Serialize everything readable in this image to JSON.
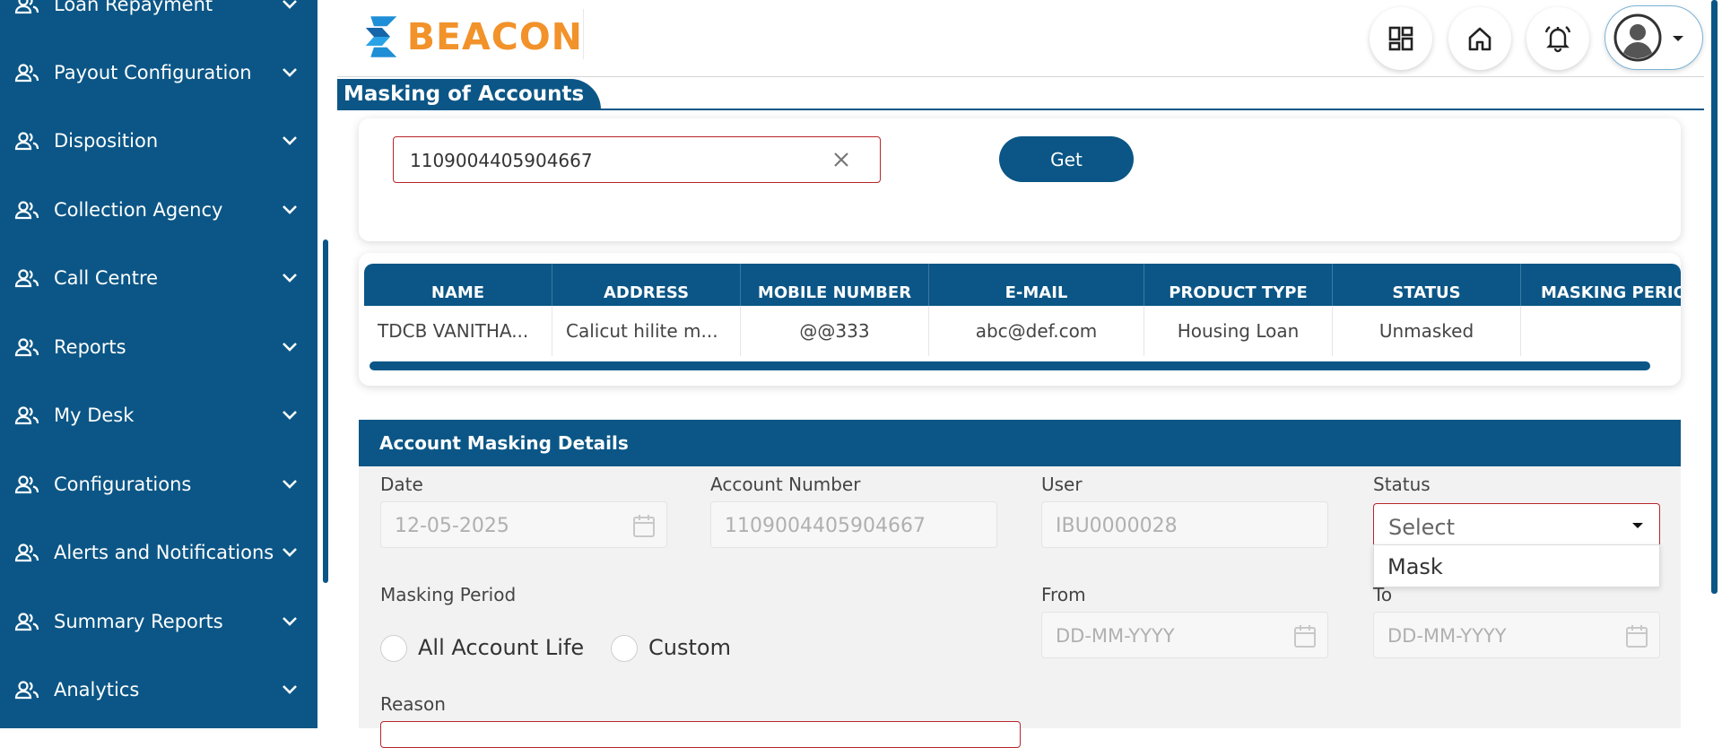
{
  "sidebar": {
    "items": [
      {
        "label": "Loan Repayment",
        "icon": "users-icon"
      },
      {
        "label": "Payout Configuration",
        "icon": "users-icon"
      },
      {
        "label": "Disposition",
        "icon": "users-icon"
      },
      {
        "label": "Collection Agency",
        "icon": "users-icon"
      },
      {
        "label": "Call Centre",
        "icon": "users-icon"
      },
      {
        "label": "Reports",
        "icon": "users-icon"
      },
      {
        "label": "My Desk",
        "icon": "users-icon"
      },
      {
        "label": "Configurations",
        "icon": "users-icon"
      },
      {
        "label": "Alerts and Notifications",
        "icon": "users-icon"
      },
      {
        "label": "Summary Reports",
        "icon": "users-icon"
      },
      {
        "label": "Analytics",
        "icon": "users-icon"
      }
    ]
  },
  "header": {
    "logo_text": "BEACON",
    "icons": [
      "dashboard-icon",
      "home-icon",
      "bell-icon",
      "avatar-icon"
    ]
  },
  "page": {
    "title": "Masking of Accounts"
  },
  "search": {
    "value": "1109004405904667",
    "get_label": "Get"
  },
  "table": {
    "columns": [
      "NAME",
      "ADDRESS",
      "MOBILE NUMBER",
      "E-MAIL",
      "PRODUCT TYPE",
      "STATUS",
      "MASKING PERIO"
    ],
    "row": [
      "TDCB VANITHA...",
      "Calicut hilite m...",
      "@@333",
      "abc@def.com",
      "Housing Loan",
      "Unmasked",
      ""
    ]
  },
  "details": {
    "title": "Account Masking Details",
    "date_label": "Date",
    "date_value": "12-05-2025",
    "account_label": "Account Number",
    "account_value": "1109004405904667",
    "user_label": "User",
    "user_value": "IBU0000028",
    "status_label": "Status",
    "status_value": "Select",
    "status_options": [
      "Mask"
    ],
    "masking_period_label": "Masking Period",
    "radio_all": "All Account Life",
    "radio_custom": "Custom",
    "from_label": "From",
    "from_placeholder": "DD-MM-YYYY",
    "to_label": "To",
    "to_placeholder": "DD-MM-YYYY",
    "reason_label": "Reason"
  },
  "colors": {
    "primary": "#0b5686",
    "logo_orange": "#f2922a",
    "logo_blue": "#1e8fd6",
    "error_border": "#b8262b"
  }
}
